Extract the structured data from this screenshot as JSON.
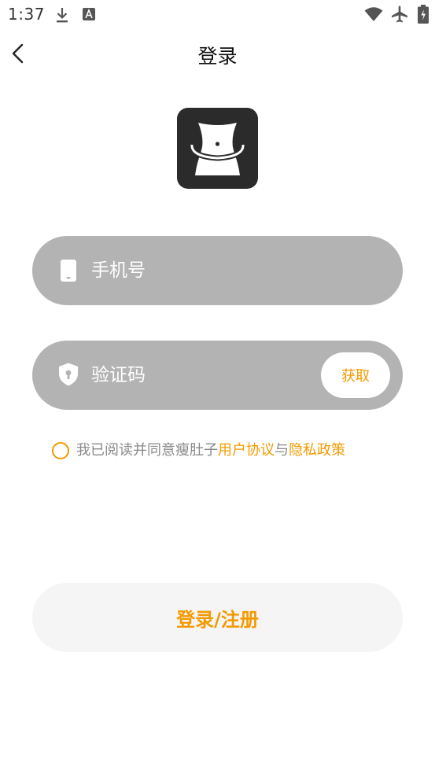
{
  "status_bar": {
    "time": "1:37",
    "icons": [
      "download-icon",
      "a-badge-icon",
      "wifi-icon",
      "airplane-icon",
      "battery-icon"
    ]
  },
  "header": {
    "title": "登录",
    "back_icon": "chevron-left-icon"
  },
  "logo": {
    "icon": "waist-measure-logo",
    "background": "#2b2b2b"
  },
  "phone_field": {
    "icon": "phone-icon",
    "placeholder": "手机号",
    "value": ""
  },
  "code_field": {
    "icon": "shield-lock-icon",
    "placeholder": "验证码",
    "value": "",
    "get_code_label": "获取"
  },
  "agreement": {
    "checked": false,
    "prefix": "我已阅读并同意瘦肚子",
    "user_agreement": "用户协议",
    "conjunction": "与",
    "privacy_policy": "隐私政策"
  },
  "login": {
    "label": "登录/注册"
  },
  "colors": {
    "accent": "#f39a00",
    "field_background": "#b3b3b3",
    "button_background": "#f5f5f5",
    "muted_text": "#8a8a8a"
  }
}
